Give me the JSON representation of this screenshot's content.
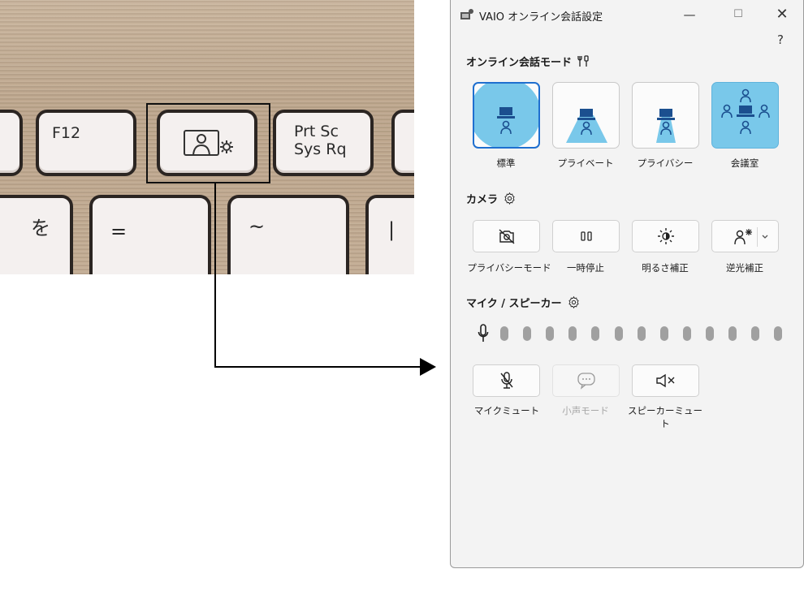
{
  "keyboard": {
    "keys": {
      "f12": "F12",
      "prtsc_top": "Prt Sc",
      "prtsc_bottom": "Sys Rq",
      "wo": "を",
      "equals": "=",
      "tilde": "~",
      "pipe": "|"
    }
  },
  "window": {
    "title": "VAIO オンライン会話設定",
    "controls": {
      "minimize": "—",
      "maximize": "☐",
      "close": "✕",
      "help": "?"
    }
  },
  "sections": {
    "mode": {
      "title": "オンライン会話モード",
      "icon": "tools-icon",
      "tiles": [
        {
          "label": "標準",
          "state": "selected"
        },
        {
          "label": "プライベート",
          "state": "normal"
        },
        {
          "label": "プライバシー",
          "state": "normal"
        },
        {
          "label": "会議室",
          "state": "active"
        }
      ]
    },
    "camera": {
      "title": "カメラ",
      "icon": "gear-icon",
      "buttons": [
        {
          "label": "プライバシーモード",
          "icon": "camera-off-icon"
        },
        {
          "label": "一時停止",
          "icon": "pause-icon"
        },
        {
          "label": "明るさ補正",
          "icon": "brightness-icon"
        },
        {
          "label": "逆光補正",
          "icon": "backlight-icon"
        }
      ]
    },
    "audio": {
      "title": "マイク / スピーカー",
      "icon": "gear-icon",
      "mic_level": 0,
      "buttons": [
        {
          "label": "マイクミュート",
          "icon": "mic-mute-icon",
          "enabled": true
        },
        {
          "label": "小声モード",
          "icon": "chat-bubble-icon",
          "enabled": false
        },
        {
          "label": "スピーカーミュート",
          "icon": "speaker-mute-icon",
          "enabled": true
        }
      ]
    }
  },
  "colors": {
    "accent": "#1f6fcf",
    "tile_active": "#79c8ea",
    "person": "#1b4f8f"
  }
}
